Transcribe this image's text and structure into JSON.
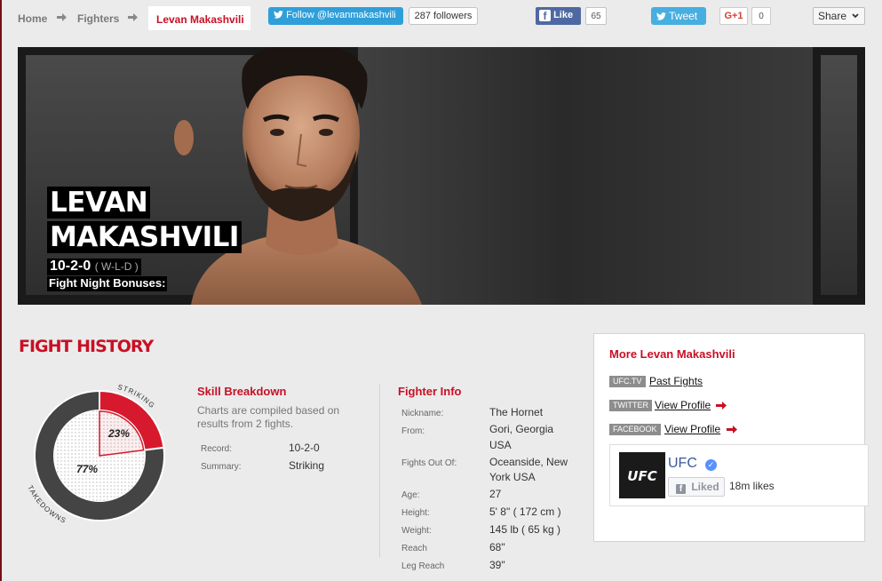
{
  "breadcrumb": {
    "home": "Home",
    "fighters": "Fighters",
    "current": "Levan Makashvili"
  },
  "social": {
    "twitter_follow": "Follow @levanmakashvili",
    "twitter_followers": "287 followers",
    "fb_like": "Like",
    "fb_like_count": "65",
    "tweet": "Tweet",
    "gplus": "G+1",
    "gplus_count": "0",
    "share": "Share"
  },
  "hero": {
    "first_name": "LEVAN",
    "last_name": "MAKASHVILI",
    "record": "10-2-0",
    "record_format": "( W-L-D )",
    "bonuses_label": "Fight Night Bonuses:"
  },
  "fight_history": {
    "title": "FIGHT HISTORY",
    "chart_data": {
      "type": "pie",
      "categories": [
        "STRIKING",
        "TAKEDOWNS"
      ],
      "values": [
        23,
        77
      ],
      "value_labels": [
        "23%",
        "77%"
      ],
      "colors": [
        "#d7192e",
        "#444444"
      ]
    },
    "skill_breakdown": {
      "title": "Skill Breakdown",
      "description": "Charts are compiled based on results from 2 fights.",
      "record_label": "Record:",
      "record_value": "10-2-0",
      "summary_label": "Summary:",
      "summary_value": "Striking"
    },
    "fighter_info": {
      "title": "Fighter Info",
      "rows": [
        {
          "label": "Nickname:",
          "value": "The Hornet"
        },
        {
          "label": "From:",
          "value_lines": [
            "Gori, Georgia",
            "USA"
          ]
        },
        {
          "label": "Fights Out Of:",
          "value_lines": [
            "Oceanside, New",
            "York USA"
          ]
        },
        {
          "label": "Age:",
          "value": "27"
        },
        {
          "label": "Height:",
          "value": "5' 8\" ( 172 cm )"
        },
        {
          "label": "Weight:",
          "value": "145 lb ( 65 kg )"
        },
        {
          "label": "Reach",
          "value": "68\""
        },
        {
          "label": "Leg Reach",
          "value": "39\""
        }
      ]
    }
  },
  "more": {
    "title": "More Levan Makashvili",
    "links": [
      {
        "tag": "UFC.TV",
        "label": "Past Fights"
      },
      {
        "tag": "TWITTER",
        "label": "View Profile"
      },
      {
        "tag": "FACEBOOK",
        "label": "View Profile"
      }
    ],
    "facebook_page": {
      "logo": "UFC",
      "name": "UFC",
      "liked": "Liked",
      "likes": "18m likes"
    }
  },
  "colors": {
    "accent": "#c81025",
    "striking": "#d7192e",
    "takedowns": "#444444"
  }
}
